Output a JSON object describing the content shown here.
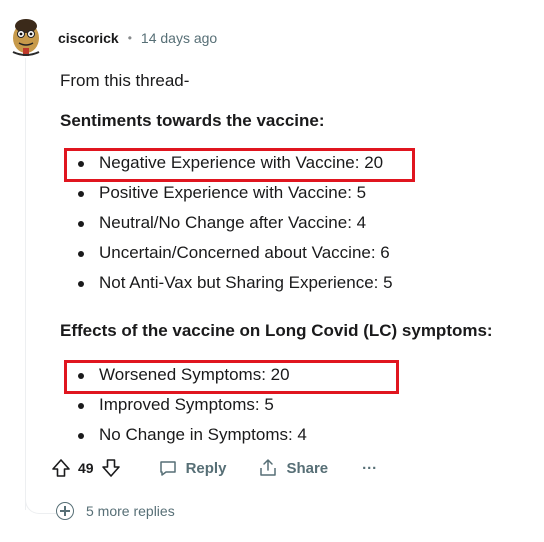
{
  "comment": {
    "username": "ciscorick",
    "separator": "•",
    "timestamp": "14 days ago",
    "intro": "From this thread-",
    "section1": {
      "heading": "Sentiments towards the vaccine:",
      "items": [
        "Negative Experience with Vaccine: 20",
        "Positive Experience with Vaccine: 5",
        "Neutral/No Change after Vaccine: 4",
        "Uncertain/Concerned about Vaccine: 6",
        "Not Anti-Vax but Sharing Experience: 5"
      ]
    },
    "section2": {
      "heading": "Effects of the vaccine on Long Covid (LC) symptoms:",
      "items": [
        "Worsened Symptoms: 20",
        "Improved Symptoms: 5",
        "No Change in Symptoms: 4"
      ]
    },
    "highlight_color": "#e0151f"
  },
  "actions": {
    "vote_count": "49",
    "reply_label": "Reply",
    "share_label": "Share",
    "more_label": "···"
  },
  "replies": {
    "more_label": "5 more replies"
  }
}
